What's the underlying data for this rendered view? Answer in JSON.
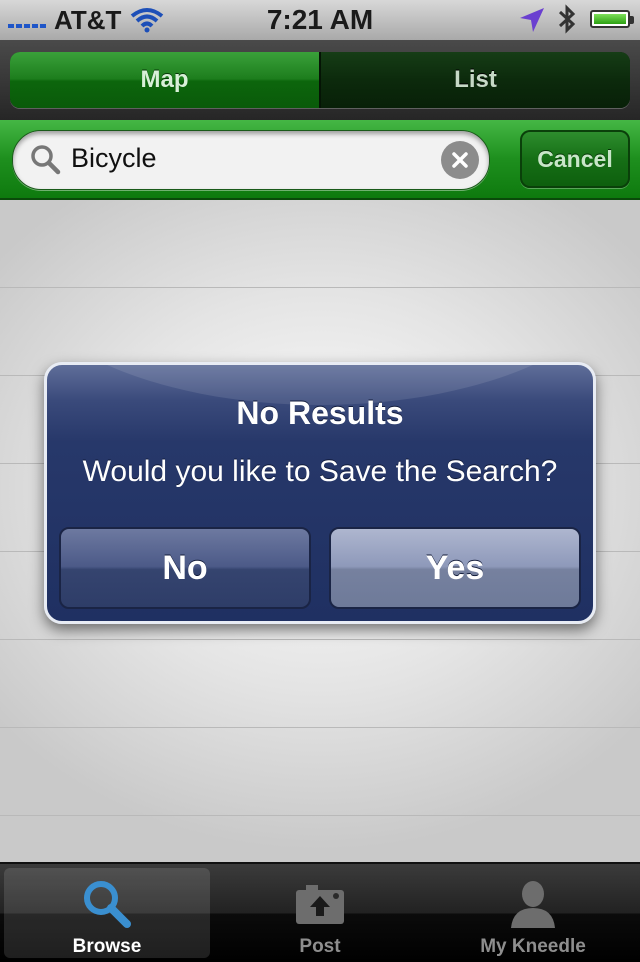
{
  "status_bar": {
    "carrier": "AT&T",
    "time": "7:21 AM",
    "icons": [
      "signal-icon",
      "wifi-icon",
      "location-icon",
      "bluetooth-icon",
      "battery-icon"
    ]
  },
  "segmented": {
    "tabs": [
      {
        "label": "Map",
        "selected": true
      },
      {
        "label": "List",
        "selected": false
      }
    ]
  },
  "search": {
    "value": "Bicycle",
    "cancel_label": "Cancel",
    "icons": [
      "search-icon",
      "clear-icon"
    ]
  },
  "alert": {
    "title": "No Results",
    "message": "Would you like to Save the Search?",
    "buttons": [
      {
        "label": "No"
      },
      {
        "label": "Yes"
      }
    ]
  },
  "tab_bar": {
    "items": [
      {
        "label": "Browse",
        "icon": "magnifier-icon",
        "selected": true
      },
      {
        "label": "Post",
        "icon": "camera-upload-icon",
        "selected": false
      },
      {
        "label": "My Kneedle",
        "icon": "person-icon",
        "selected": false
      }
    ]
  },
  "colors": {
    "accent_green": "#1e8f1e",
    "alert_blue": "#27386a",
    "tab_selected_icon": "#3a8fd0"
  }
}
